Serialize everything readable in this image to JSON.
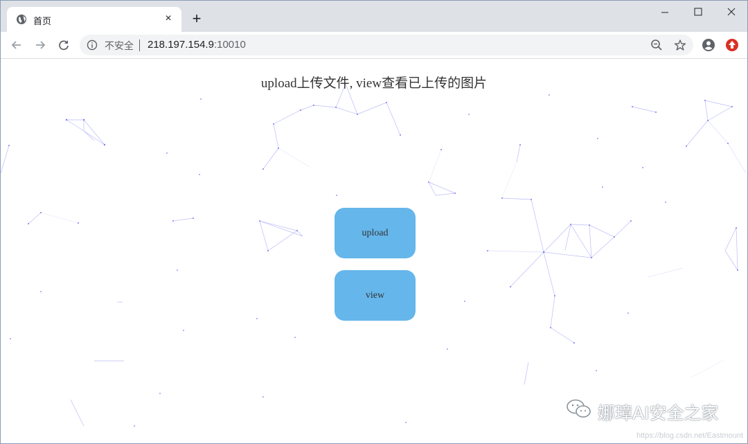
{
  "browser": {
    "tab": {
      "title": "首页",
      "favicon": "globe-icon",
      "close": "×"
    },
    "new_tab": "+",
    "window_controls": [
      "minimize-icon",
      "maximize-icon",
      "close-icon"
    ],
    "toolbar": {
      "back": "arrow-left-icon",
      "forward": "arrow-right-icon",
      "reload": "reload-icon",
      "security_label": "不安全",
      "url_host": "218.197.154.9",
      "url_port": ":10010",
      "zoom": "zoom-out-icon",
      "bookmark": "star-icon",
      "profile": "account-icon",
      "extension": "update-icon"
    }
  },
  "page": {
    "headline": "upload上传文件, view查看已上传的图片",
    "buttons": {
      "upload": "upload",
      "view": "view"
    },
    "background": "particle-network",
    "line_color": "#7b7bf0"
  },
  "watermark": {
    "text": "娜璋AI安全之家",
    "source": "https://blog.csdn.net/Eastmount",
    "icon": "wechat-icon"
  },
  "colors": {
    "button_fill": "#65b6eb",
    "tabstrip": "#dee1e6",
    "omnibox": "#f1f3f4",
    "extension_red": "#d93025"
  }
}
